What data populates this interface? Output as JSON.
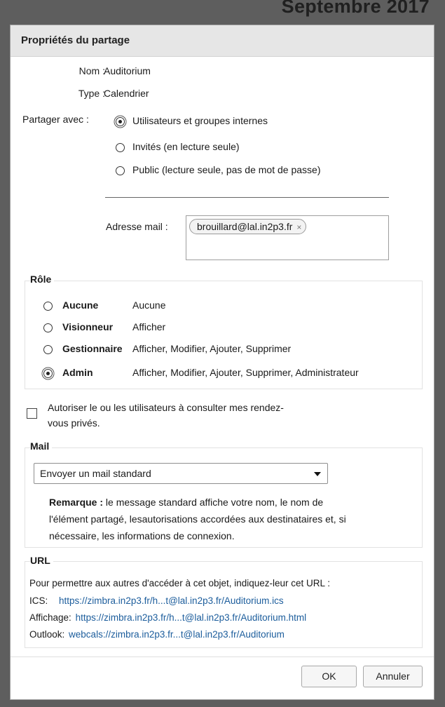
{
  "background": {
    "title": "Septembre 2017"
  },
  "dialog": {
    "title": "Propriétés du partage",
    "name_label": "Nom :",
    "name_value": "Auditorium",
    "type_label": "Type :",
    "type_value": "Calendrier",
    "share_with_label": "Partager avec :",
    "share_options": [
      {
        "label": "Utilisateurs et groupes internes",
        "selected": true
      },
      {
        "label": "Invités (en lecture seule)",
        "selected": false
      },
      {
        "label": "Public (lecture seule, pas de mot de passe)",
        "selected": false
      }
    ],
    "email_label": "Adresse mail :",
    "email_bubble": "brouillard@lal.in2p3.fr",
    "email_bubble_remove": "×",
    "role": {
      "legend": "Rôle",
      "options": [
        {
          "name": "Aucune",
          "desc": "Aucune",
          "selected": false
        },
        {
          "name": "Visionneur",
          "desc": "Afficher",
          "selected": false
        },
        {
          "name": "Gestionnaire",
          "desc": "Afficher, Modifier, Ajouter, Supprimer",
          "selected": false
        },
        {
          "name": "Admin",
          "desc": "Afficher, Modifier, Ajouter, Supprimer, Administrateur",
          "selected": true
        }
      ]
    },
    "private_checkbox": {
      "line1": "Autoriser le ou les utilisateurs à consulter mes rendez-",
      "line2": "vous privés.",
      "checked": false
    },
    "mail": {
      "legend": "Mail",
      "select_value": "Envoyer un mail standard",
      "note_bold": "Remarque :",
      "note_line1": " le message standard affiche votre nom, le nom de",
      "note_line2": "l'élément partagé, lesautorisations accordées aux destinataires et, si",
      "note_line3": "nécessaire, les informations de connexion."
    },
    "url": {
      "legend": "URL",
      "intro": "Pour permettre aux autres d'accéder à cet objet, indiquez-leur cet URL :",
      "ics_label": "ICS:",
      "ics_link": "https://zimbra.in2p3.fr/h...t@lal.in2p3.fr/Auditorium.ics",
      "html_label": "Affichage:",
      "html_link": "https://zimbra.in2p3.fr/h...t@lal.in2p3.fr/Auditorium.html",
      "outlook_label": "Outlook:",
      "outlook_link": "webcals://zimbra.in2p3.fr...t@lal.in2p3.fr/Auditorium"
    },
    "buttons": {
      "ok": "OK",
      "cancel": "Annuler"
    }
  },
  "colors": {
    "link": "#1c5d9c",
    "titlebar": "#e6e6e6",
    "backdrop": "#5e5e5e"
  }
}
